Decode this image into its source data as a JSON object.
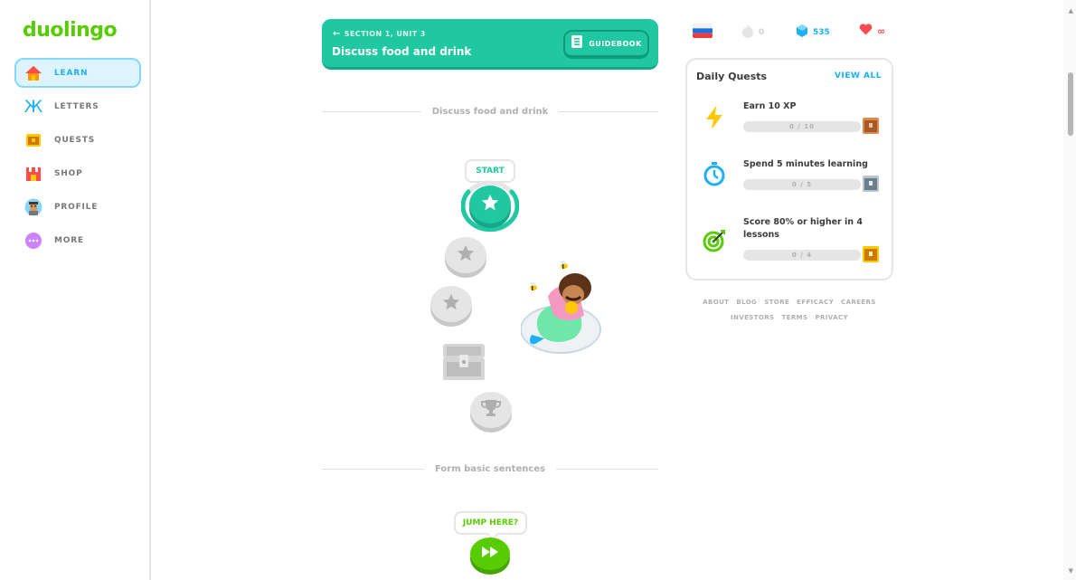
{
  "logo": "duolingo",
  "sidebar": {
    "items": [
      {
        "label": "LEARN"
      },
      {
        "label": "LETTERS"
      },
      {
        "label": "QUESTS"
      },
      {
        "label": "SHOP"
      },
      {
        "label": "PROFILE"
      },
      {
        "label": "MORE"
      }
    ]
  },
  "unit": {
    "section_label": "SECTION 1, UNIT 3",
    "title": "Discuss food and drink",
    "guidebook_label": "GUIDEBOOK"
  },
  "path": {
    "divider1": "Discuss food and drink",
    "start_label": "START",
    "divider2": "Form basic sentences",
    "jump_label": "JUMP HERE?"
  },
  "stats": {
    "streak": "0",
    "gems": "535",
    "hearts": "∞"
  },
  "quests": {
    "title": "Daily Quests",
    "view_all": "VIEW ALL",
    "items": [
      {
        "label": "Earn 10 XP",
        "progress": "0 / 10",
        "icon": "lightning-icon"
      },
      {
        "label": "Spend 5 minutes learning",
        "progress": "0 / 5",
        "icon": "timer-icon"
      },
      {
        "label": "Score 80% or higher in 4 lessons",
        "progress": "0 / 4",
        "icon": "target-icon"
      }
    ]
  },
  "footer": {
    "row1": [
      "ABOUT",
      "BLOG",
      "STORE",
      "EFFICACY",
      "CAREERS"
    ],
    "row2": [
      "INVESTORS",
      "TERMS",
      "PRIVACY"
    ]
  },
  "colors": {
    "brand_green": "#58cc02",
    "unit_teal": "#1fc8a0",
    "accent_blue": "#1cb0f6",
    "heart_red": "#ff4b4b"
  }
}
